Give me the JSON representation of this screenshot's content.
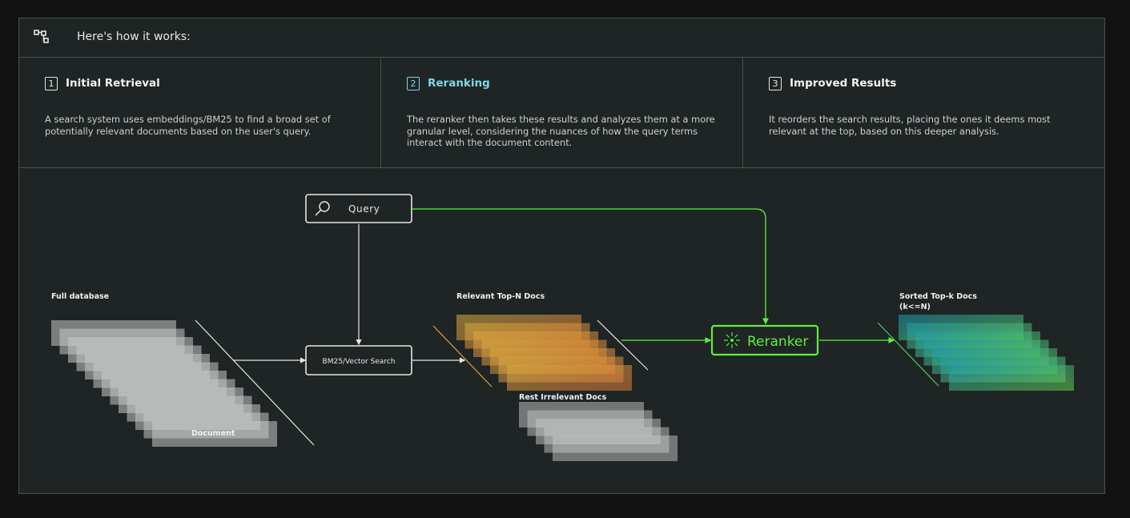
{
  "header": {
    "icon": "flow-diagram-icon",
    "title": "Here's how it works:"
  },
  "steps": [
    {
      "number": "1",
      "title": "Initial Retrieval",
      "description": "A search system uses embeddings/BM25 to find a broad set of potentially relevant documents based on the user's query."
    },
    {
      "number": "2",
      "title": "Reranking",
      "description": "The reranker then takes these results and analyzes them at a more granular level, considering the nuances of how the query terms interact with the document content."
    },
    {
      "number": "3",
      "title": "Improved Results",
      "description": "It reorders the search results, placing the ones it deems most relevant at the top, based on this deeper analysis."
    }
  ],
  "diagram": {
    "query_label": "Query",
    "search_label": "BM25/Vector Search",
    "reranker_label": "Reranker",
    "full_db_label": "Full database",
    "document_label": "Document",
    "relevant_label": "Relevant Top-N Docs",
    "irrelevant_label": "Rest Irrelevant Docs",
    "sorted_label_line1": "Sorted Top-k Docs",
    "sorted_label_line2": "(k<=N)",
    "colors": {
      "accent_green": "#5ef03c",
      "active_step": "#7fd6e6",
      "relevant_start": "#d8b040",
      "relevant_end": "#e07a3a",
      "sorted_start": "#1a9ab8",
      "sorted_end": "#6ad24a"
    }
  }
}
